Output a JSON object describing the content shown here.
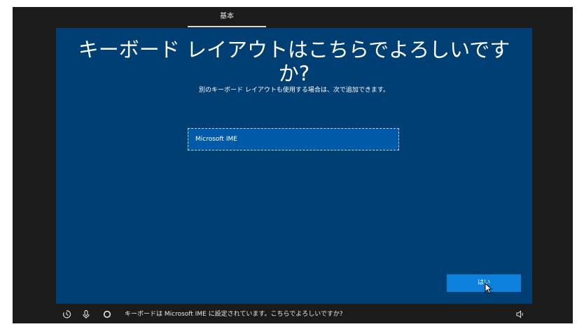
{
  "step": {
    "label": "基本"
  },
  "page": {
    "title": "キーボード レイアウトはこちらでよろしいですか?",
    "subtitle": "別のキーボード レイアウトも使用する場合は、次で追加できます。"
  },
  "keyboard_list": {
    "items": [
      {
        "label": "Microsoft IME",
        "selected": true
      }
    ]
  },
  "actions": {
    "yes_label": "はい"
  },
  "taskbar": {
    "icons": [
      "ease-of-access-icon",
      "microphone-icon",
      "cortana-icon",
      "volume-icon"
    ],
    "caption": "キーボードは Microsoft IME に設定されています。こちらでよろしいですか?"
  },
  "colors": {
    "panel_background": "#003f74",
    "selected_item": "#005aa8",
    "primary_button": "#0d7fdc",
    "frame": "#1b1b1b"
  }
}
